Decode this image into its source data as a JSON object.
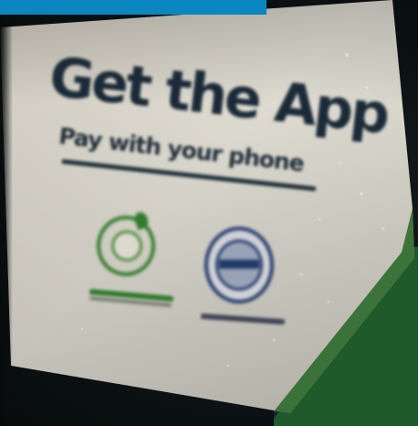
{
  "sticker": {
    "headline": "Get the App",
    "subline": "Pay with your phone"
  },
  "colors": {
    "top_bar": "#0a86c0",
    "sticker_paper": "#d8d5c9",
    "ink": "#1a2a38",
    "logo_green": "#2f7a2a",
    "logo_navy": "#223a6a",
    "background_blue": "#163a63"
  },
  "icons": {
    "left_logo": "green-circular-seal-icon",
    "right_logo": "navy-circular-seal-icon"
  }
}
